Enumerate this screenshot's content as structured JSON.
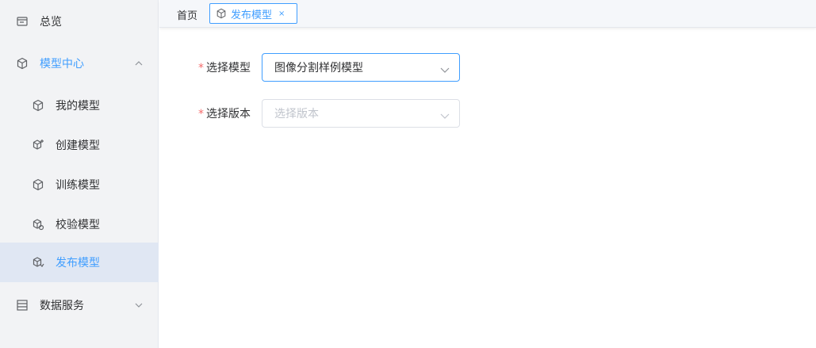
{
  "sidebar": {
    "items": [
      {
        "label": "总览",
        "icon": "overview-icon"
      },
      {
        "label": "模型中心",
        "icon": "cube-icon"
      },
      {
        "label": "我的模型",
        "icon": "cube-icon"
      },
      {
        "label": "创建模型",
        "icon": "cube-plus-icon"
      },
      {
        "label": "训练模型",
        "icon": "cube-icon"
      },
      {
        "label": "校验模型",
        "icon": "cube-check-icon"
      },
      {
        "label": "发布模型",
        "icon": "cube-publish-icon"
      },
      {
        "label": "数据服务",
        "icon": "server-icon"
      }
    ]
  },
  "tabs": {
    "home": "首页",
    "active": "发布模型",
    "close": "×"
  },
  "form": {
    "model": {
      "label": "选择模型",
      "value": "图像分割样例模型"
    },
    "version": {
      "label": "选择版本",
      "placeholder": "选择版本"
    }
  },
  "colors": {
    "accent": "#409eff",
    "required": "#f56c6c"
  }
}
